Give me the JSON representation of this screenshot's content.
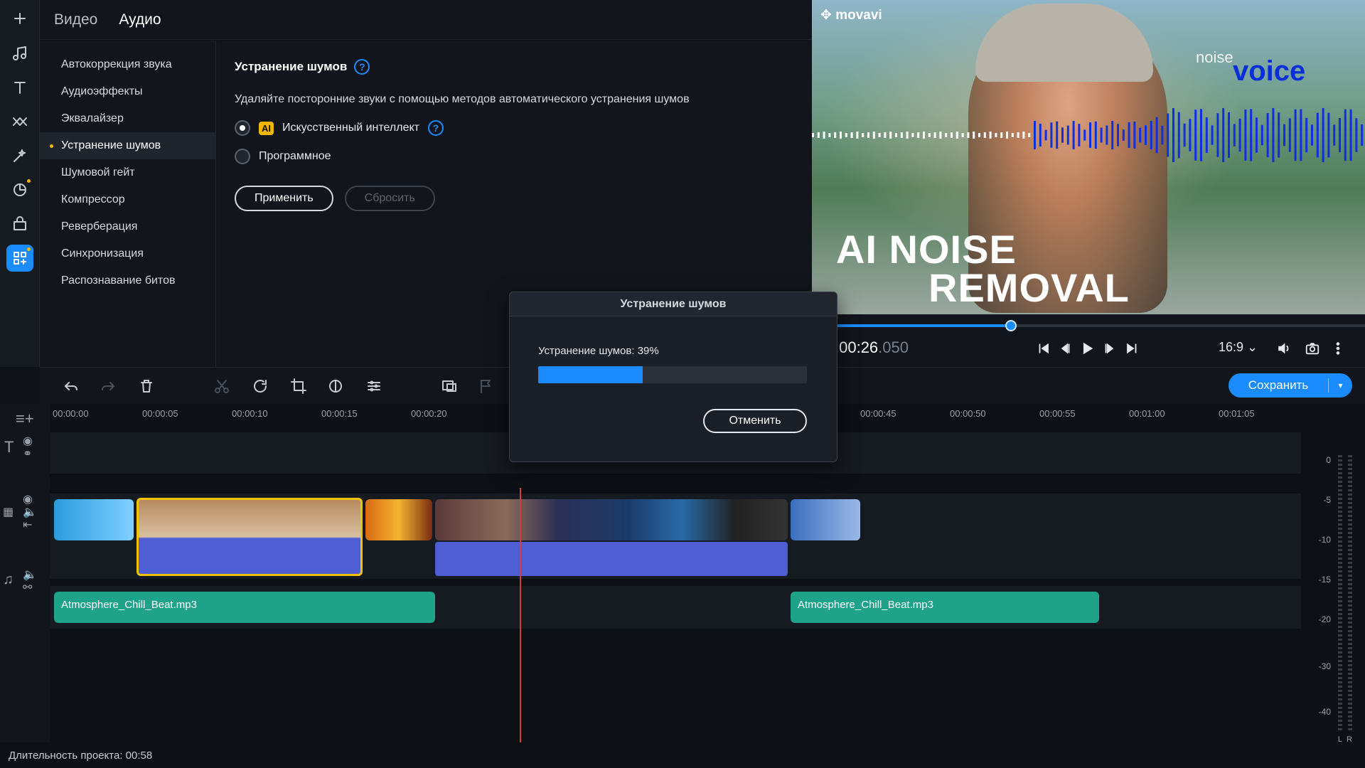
{
  "colors": {
    "accent": "#1a8cff",
    "highlight": "#f2b705",
    "audio_clip": "#1ea38a",
    "playhead": "#d93b3b"
  },
  "rail": {
    "icons": [
      "plus-icon",
      "music-icon",
      "text-icon",
      "transitions-icon",
      "magic-icon",
      "sticker-icon",
      "store-icon",
      "more-tools-icon"
    ]
  },
  "tabs": {
    "video": "Видео",
    "audio": "Аудио"
  },
  "categories": [
    "Автокоррекция звука",
    "Аудиоэффекты",
    "Эквалайзер",
    "Устранение шумов",
    "Шумовой гейт",
    "Компрессор",
    "Реверберация",
    "Синхронизация",
    "Распознавание битов"
  ],
  "settings": {
    "title": "Устранение шумов",
    "help": "?",
    "description": "Удаляйте посторонние звуки с помощью методов автоматического устранения шумов",
    "ai_badge": "AI",
    "option_ai": "Искусственный интеллект",
    "option_soft": "Программное",
    "apply": "Применить",
    "reset": "Сбросить",
    "selected_option": "ai"
  },
  "preview": {
    "brand": "movavi",
    "word_noise": "noise",
    "word_voice": "voice",
    "title_line1": "AI NOISE",
    "title_line2": "REMOVAL"
  },
  "player": {
    "timecode_main": ":00:26",
    "timecode_ms": ".050",
    "seek_progress": 0.33,
    "aspect_ratio": "16:9 ⌄"
  },
  "toolbar": {
    "save": "Сохранить",
    "save_arrow": "▾"
  },
  "ruler": [
    "00:00:00",
    "00:00:05",
    "00:00:10",
    "00:00:15",
    "00:00:20",
    "00:00:45",
    "00:00:50",
    "00:00:55",
    "00:01:00",
    "00:01:05"
  ],
  "audio_clips": [
    "Atmosphere_Chill_Beat.mp3",
    "Atmosphere_Chill_Beat.mp3"
  ],
  "meter": {
    "labels": [
      "0",
      "-5",
      "-10",
      "-15",
      "-20",
      "-30",
      "-40"
    ],
    "channels": [
      "L",
      "R"
    ]
  },
  "status": {
    "duration": "Длительность проекта: 00:58"
  },
  "dialog": {
    "title": "Устранение шумов",
    "message": "Устранение шумов: 39%",
    "progress": 0.39,
    "cancel": "Отменить"
  }
}
